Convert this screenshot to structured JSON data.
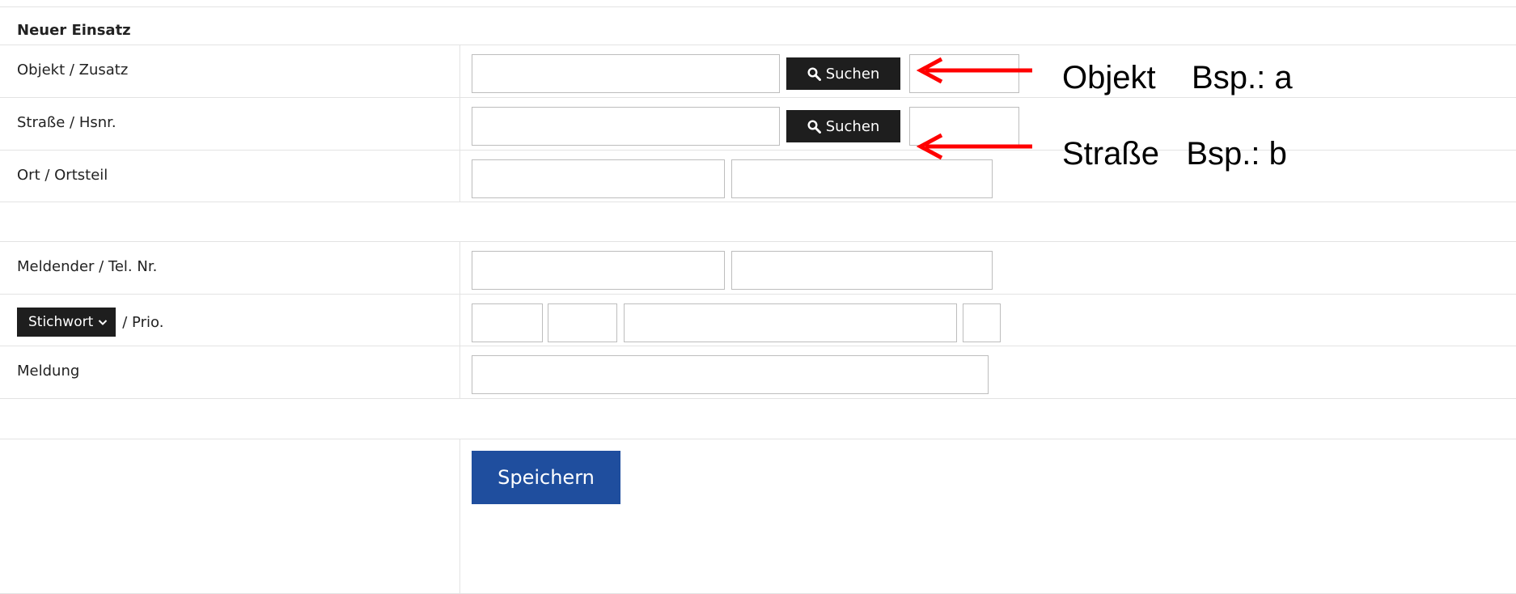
{
  "form": {
    "title": "Neuer Einsatz",
    "rows": {
      "objekt": {
        "label": "Objekt / Zusatz",
        "search_label": "Suchen",
        "value1": "",
        "value2": ""
      },
      "strasse": {
        "label": "Straße / Hsnr.",
        "search_label": "Suchen",
        "value1": "",
        "value2": ""
      },
      "ort": {
        "label": "Ort / Ortsteil",
        "value1": "",
        "value2": ""
      },
      "meldender": {
        "label": "Meldender / Tel. Nr.",
        "value1": "",
        "value2": ""
      },
      "stichwort": {
        "button_label": "Stichwort",
        "label_suffix": "/ Prio.",
        "v1": "",
        "v2": "",
        "v3": "",
        "v4": ""
      },
      "meldung": {
        "label": "Meldung",
        "value": ""
      }
    },
    "save_label": "Speichern"
  },
  "annotations": {
    "objekt": "Objekt    Bsp.: a",
    "strasse": "Straße   Bsp.: b"
  },
  "colors": {
    "button_dark": "#1e1e1e",
    "save_button": "#1f4e9e",
    "annotation_arrow": "#ff0000",
    "border": "#bdbdbd"
  },
  "icons": {
    "search": "search-icon",
    "dropdown": "chevron-down-icon",
    "arrow": "arrow-left-icon"
  }
}
